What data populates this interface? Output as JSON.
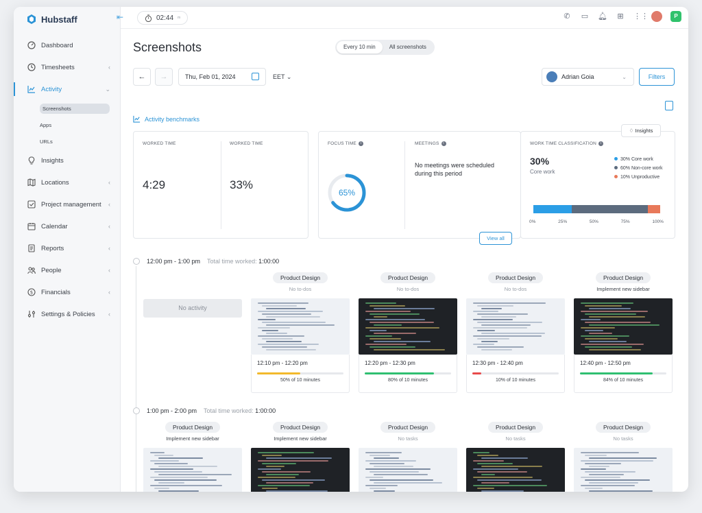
{
  "app": {
    "name": "Hubstaff",
    "timer": "02:44",
    "timer_suffix": "m",
    "user_initial": "P"
  },
  "sidebar": {
    "items": [
      {
        "label": "Dashboard",
        "icon": "dashboard-icon",
        "chevron": false
      },
      {
        "label": "Timesheets",
        "icon": "clock-icon",
        "chevron": true
      },
      {
        "label": "Activity",
        "icon": "activity-chart-icon",
        "chevron": true,
        "active": true
      },
      {
        "label": "Insights",
        "icon": "lightbulb-icon",
        "chevron": false
      },
      {
        "label": "Locations",
        "icon": "map-icon",
        "chevron": true
      },
      {
        "label": "Project management",
        "icon": "checkbox-icon",
        "chevron": true
      },
      {
        "label": "Calendar",
        "icon": "calendar-icon",
        "chevron": true
      },
      {
        "label": "Reports",
        "icon": "report-icon",
        "chevron": true
      },
      {
        "label": "People",
        "icon": "people-icon",
        "chevron": true
      },
      {
        "label": "Financials",
        "icon": "dollar-icon",
        "chevron": true
      },
      {
        "label": "Settings & Policies",
        "icon": "settings-icon",
        "chevron": true
      }
    ],
    "activity_sub": [
      "Screenshots",
      "Apps",
      "URLs"
    ]
  },
  "header": {
    "title": "Screenshots",
    "toggle": [
      "Every 10 min",
      "All screenshots"
    ],
    "date": "Thu, Feb 01, 2024",
    "timezone": "EET",
    "user": "Adrian Goia",
    "filters": "Filters",
    "benchmarks": "Activity benchmarks"
  },
  "stats": {
    "worked_time_label": "WORKED TIME",
    "worked_time": "4:29",
    "worked_pct_label": "WORKED TIME",
    "worked_pct": "33%",
    "focus_label": "FOCUS TIME",
    "focus_value": "65%",
    "focus_fraction": 0.65,
    "meetings_label": "MEETINGS",
    "meetings_text": "No meetings were scheduled during this period",
    "view_all": "View all",
    "insights": "Insights",
    "classification_label": "WORK TIME CLASSIFICATION",
    "core_pct": "30%",
    "core_label": "Core work",
    "legend": [
      {
        "label": "30% Core work",
        "color": "#2b9ee6",
        "value": 30
      },
      {
        "label": "60% Non-core work",
        "color": "#5c6b7e",
        "value": 60
      },
      {
        "label": "10% Unproductive",
        "color": "#e8795a",
        "value": 10
      }
    ],
    "axis": [
      "0%",
      "25%",
      "50%",
      "75%",
      "100%"
    ]
  },
  "timeline": [
    {
      "range": "12:00 pm - 1:00 pm",
      "total_label": "Total time worked:",
      "total": "1:00:00",
      "no_activity": "No activity",
      "shots": [
        {
          "project": "Product Design",
          "task": "No to-dos",
          "theme": "light",
          "time": "12:10 pm - 12:20 pm",
          "pct": "50% of 10 minutes",
          "fraction": 0.5,
          "color": "#f2b92c"
        },
        {
          "project": "Product Design",
          "task": "No to-dos",
          "theme": "dark",
          "time": "12:20 pm - 12:30 pm",
          "pct": "80% of 10 minutes",
          "fraction": 0.8,
          "color": "#2fbf71"
        },
        {
          "project": "Product Design",
          "task": "No to-dos",
          "theme": "light",
          "time": "12:30 pm - 12:40 pm",
          "pct": "10% of 10 minutes",
          "fraction": 0.1,
          "color": "#e84a4a"
        },
        {
          "project": "Product Design",
          "task": "Implement new sidebar",
          "theme": "dark",
          "time": "12:40 pm - 12:50 pm",
          "pct": "84% of 10 minutes",
          "fraction": 0.84,
          "color": "#2fbf71"
        }
      ]
    },
    {
      "range": "1:00 pm - 2:00 pm",
      "total_label": "Total time worked:",
      "total": "1:00:00",
      "shots": [
        {
          "project": "Product Design",
          "task": "Implement new sidebar",
          "theme": "light"
        },
        {
          "project": "Product Design",
          "task": "Implement new sidebar",
          "theme": "dark"
        },
        {
          "project": "Product Design",
          "task": "No tasks",
          "theme": "light"
        },
        {
          "project": "Product Design",
          "task": "No tasks",
          "theme": "dark"
        },
        {
          "project": "Product Design",
          "task": "No tasks",
          "theme": "light"
        }
      ]
    }
  ]
}
